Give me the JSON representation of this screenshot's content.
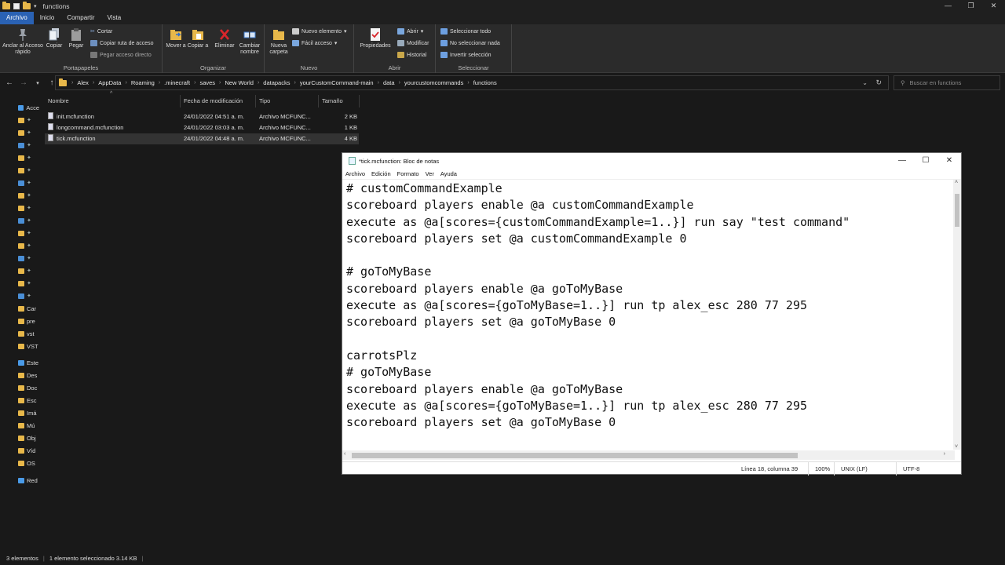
{
  "window": {
    "title": "functions",
    "controls": [
      "—",
      "❐",
      "✕"
    ]
  },
  "menu_tabs": [
    "Archivo",
    "Inicio",
    "Compartir",
    "Vista"
  ],
  "ribbon": {
    "portapapeles": {
      "label": "Portapapeles",
      "anclar": "Anclar al Acceso rápido",
      "copiar": "Copiar",
      "pegar": "Pegar",
      "cortar": "Cortar",
      "copiar_ruta": "Copiar ruta de acceso",
      "pegar_acceso": "Pegar acceso directo"
    },
    "organizar": {
      "label": "Organizar",
      "mover": "Mover a",
      "copiar": "Copiar a",
      "eliminar": "Eliminar",
      "cambiar": "Cambiar nombre"
    },
    "nuevo": {
      "label": "Nuevo",
      "carpeta": "Nueva carpeta",
      "elemento": "Nuevo elemento",
      "facil": "Fácil acceso"
    },
    "abrir": {
      "label": "Abrir",
      "propiedades": "Propiedades",
      "abrir": "Abrir",
      "modificar": "Modificar",
      "historial": "Historial"
    },
    "seleccionar": {
      "label": "Seleccionar",
      "todo": "Seleccionar todo",
      "nada": "No seleccionar nada",
      "invertir": "Invertir selección"
    }
  },
  "breadcrumbs": [
    "Alex",
    "AppData",
    "Roaming",
    ".minecraft",
    "saves",
    "New World",
    "datapacks",
    "yourCustomCommand-main",
    "data",
    "yourcustomcommands",
    "functions"
  ],
  "search": {
    "placeholder": "Buscar en functions"
  },
  "nav_items": [
    "Acce",
    "",
    "",
    "",
    "",
    "",
    "",
    "",
    "",
    "",
    "",
    "",
    "",
    "",
    "",
    "",
    "Car",
    "pre",
    "vst",
    "VST",
    "Este",
    "Des",
    "Doc",
    "Esc",
    "Imá",
    "Mú",
    "Obj",
    "Víd",
    "OS",
    "Red"
  ],
  "columns": {
    "name": "Nombre",
    "date": "Fecha de modificación",
    "type": "Tipo",
    "size": "Tamaño"
  },
  "files": [
    {
      "name": "init.mcfunction",
      "date": "24/01/2022 04:51 a. m.",
      "type": "Archivo MCFUNC...",
      "size": "2 KB"
    },
    {
      "name": "longcommand.mcfunction",
      "date": "24/01/2022 03:03 a. m.",
      "type": "Archivo MCFUNC...",
      "size": "1 KB"
    },
    {
      "name": "tick.mcfunction",
      "date": "24/01/2022 04:48 a. m.",
      "type": "Archivo MCFUNC...",
      "size": "4 KB"
    }
  ],
  "status": {
    "count": "3 elementos",
    "selection": "1 elemento seleccionado  3.14 KB"
  },
  "notepad": {
    "title": "*tick.mcfunction: Bloc de notas",
    "menu": [
      "Archivo",
      "Edición",
      "Formato",
      "Ver",
      "Ayuda"
    ],
    "lines": [
      "# customCommandExample",
      "scoreboard players enable @a customCommandExample",
      "execute as @a[scores={customCommandExample=1..}] run say \"test command\"",
      "scoreboard players set @a customCommandExample 0",
      "",
      "# goToMyBase",
      "scoreboard players enable @a goToMyBase",
      "execute as @a[scores={goToMyBase=1..}] run tp alex_esc 280 77 295",
      "scoreboard players set @a goToMyBase 0",
      "",
      "carrotsPlz",
      "# goToMyBase",
      "scoreboard players enable @a goToMyBase",
      "execute as @a[scores={goToMyBase=1..}] run tp alex_esc 280 77 295",
      "scoreboard players set @a goToMyBase 0"
    ],
    "status": {
      "position": "Línea 18, columna 39",
      "zoom": "100%",
      "eol": "UNIX (LF)",
      "encoding": "UTF-8"
    }
  }
}
